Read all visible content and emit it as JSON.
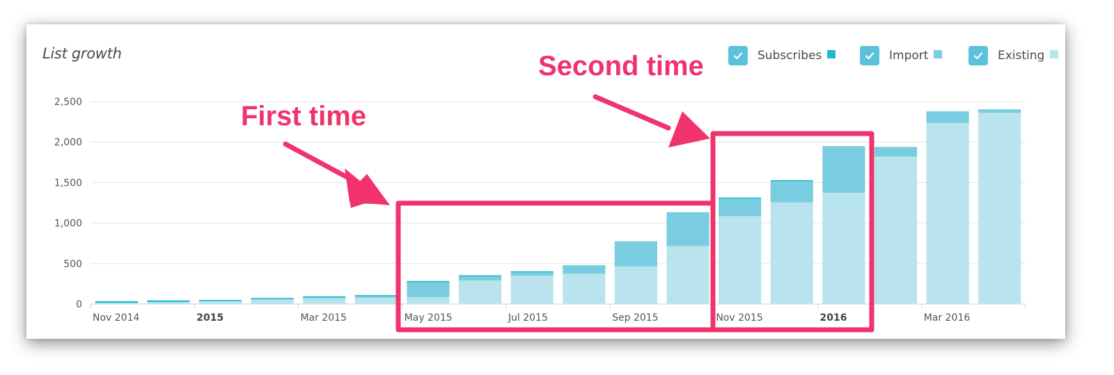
{
  "card": {
    "title": "List growth"
  },
  "legend": [
    {
      "label": "Subscribes",
      "checked": true,
      "color": "#1fb9d1"
    },
    {
      "label": "Import",
      "checked": true,
      "color": "#7acde0"
    },
    {
      "label": "Existing",
      "checked": true,
      "color": "#bae4ed"
    }
  ],
  "annotations": [
    {
      "text": "First time",
      "highlight_range": [
        "May 2015",
        "Oct 2015"
      ],
      "color": "#f0336c"
    },
    {
      "text": "Second time",
      "highlight_range": [
        "Nov 2015",
        "Jan 2016"
      ],
      "color": "#f0336c"
    }
  ],
  "chart_data": {
    "type": "bar",
    "stacked": true,
    "title": "List growth",
    "xlabel": "",
    "ylabel": "",
    "ylim": [
      0,
      2500
    ],
    "yticks": [
      0,
      500,
      1000,
      1500,
      2000,
      2500
    ],
    "ytick_labels": [
      "0",
      "500",
      "1,000",
      "1,500",
      "2,000",
      "2,500"
    ],
    "grid": true,
    "legend_position": "top-right",
    "categories": [
      "Nov 2014",
      "Dec 2014",
      "Jan 2015",
      "Feb 2015",
      "Mar 2015",
      "Apr 2015",
      "May 2015",
      "Jun 2015",
      "Jul 2015",
      "Aug 2015",
      "Sep 2015",
      "Oct 2015",
      "Nov 2015",
      "Dec 2015",
      "Jan 2016",
      "Feb 2016",
      "Mar 2016",
      "Apr 2016"
    ],
    "xtick_labels": [
      {
        "category": "Nov 2014",
        "label": "Nov 2014",
        "bold": false
      },
      {
        "category": "Jan 2015",
        "label": "2015",
        "bold": true
      },
      {
        "category": "Mar 2015",
        "label": "Mar 2015",
        "bold": false
      },
      {
        "category": "May 2015",
        "label": "May 2015",
        "bold": false
      },
      {
        "category": "Jul 2015",
        "label": "Jul 2015",
        "bold": false
      },
      {
        "category": "Sep 2015",
        "label": "Sep 2015",
        "bold": false
      },
      {
        "category": "Nov 2015",
        "label": "Nov 2015",
        "bold": false
      },
      {
        "category": "Jan 2016",
        "label": "2016",
        "bold": true
      },
      {
        "category": "Mar 2016",
        "label": "Mar 2016",
        "bold": false
      }
    ],
    "series": [
      {
        "name": "Existing",
        "color": "#bae4ed",
        "values": [
          15,
          25,
          35,
          55,
          70,
          80,
          85,
          290,
          350,
          375,
          465,
          715,
          1085,
          1255,
          1375,
          1820,
          2235,
          2360
        ]
      },
      {
        "name": "Import",
        "color": "#7acde0",
        "values": [
          0,
          0,
          0,
          15,
          15,
          20,
          195,
          60,
          45,
          105,
          310,
          420,
          225,
          265,
          575,
          120,
          145,
          45
        ]
      },
      {
        "name": "Subscribes",
        "color": "#1fb9d1",
        "values": [
          20,
          20,
          15,
          5,
          10,
          10,
          5,
          5,
          10,
          0,
          0,
          0,
          5,
          10,
          0,
          0,
          0,
          0
        ]
      }
    ]
  }
}
